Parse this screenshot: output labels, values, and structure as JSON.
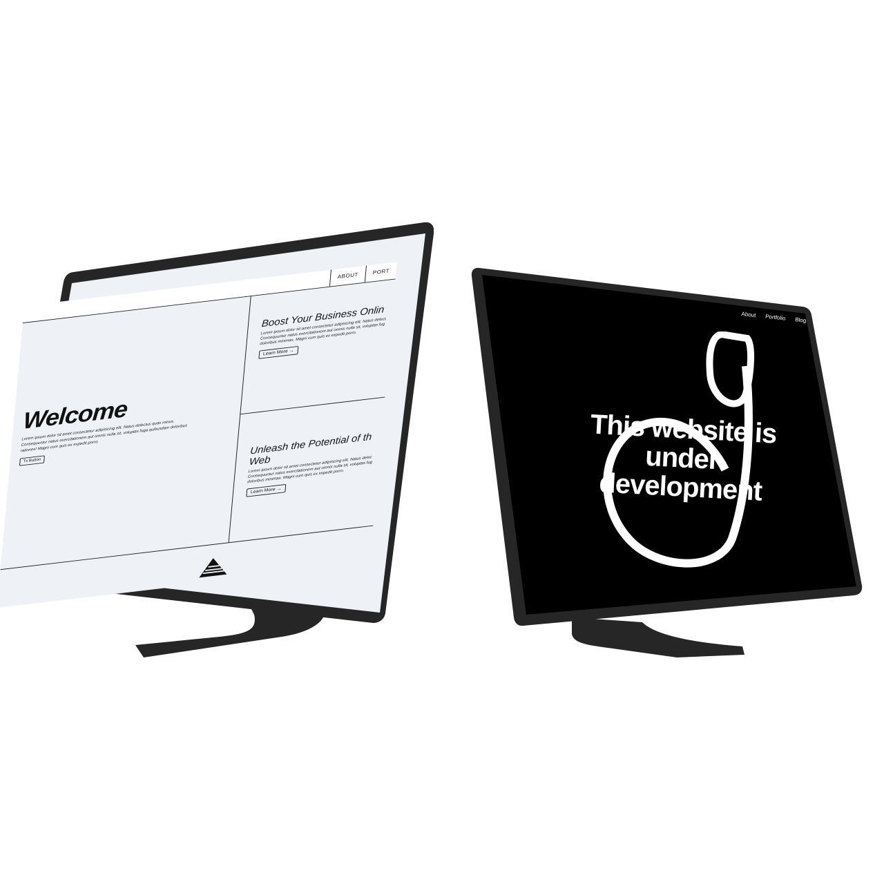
{
  "left_site": {
    "nav": [
      "ABOUT",
      "PORT"
    ],
    "hero": {
      "title": "Welcome",
      "body": "Lorem ipsum dolor sit amet consectetur adipisicing elit. Natus delectus quas minus. Consequuntur natus exercitationem aut omnis nulla sit, voluptas fuga quibusdam doloribus rationes! Magni cum quis ex expedit porro.",
      "button": "Tx Button"
    },
    "cards": [
      {
        "title": "Boost Your Business Onlin",
        "body": "Lorem ipsum dolor sit amet consectetur adipisicing elit. Natus delect. Consequuntur natus exercitationem aut omnis nulla sit, voluptas fug doloribus minimas. Magni cum quis ex expedit porro.",
        "button": "Learn More →"
      },
      {
        "title": "Unleash the Potential of th",
        "title_line2": "Web",
        "body": "Lorem ipsum dolor sit amet consectetur adipisicing elit. Natus delec Consequuntur natus exercitationem aut omnis nulla sit, voluptas fug doloribus minimas. Magni cum quis ex impedit porro.",
        "button": "Learn More →"
      }
    ]
  },
  "right_site": {
    "nav": [
      "About",
      "Portfolio",
      "Blog"
    ],
    "title": "This website is under development"
  },
  "colors": {
    "device": "#262626",
    "left_bg": "#eef2f7",
    "right_bg": "#000000",
    "text_light": "#ffffff"
  },
  "icons": [
    "arrow-right-icon",
    "triangle-logo-icon",
    "swirl-graphic-icon"
  ]
}
